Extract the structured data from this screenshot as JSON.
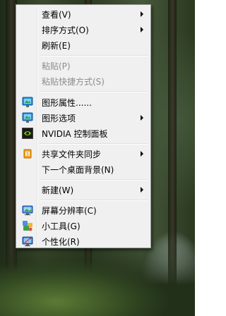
{
  "menu": {
    "items": [
      {
        "label": "查看(V)",
        "icon": "",
        "submenu": true
      },
      {
        "label": "排序方式(O)",
        "icon": "",
        "submenu": true
      },
      {
        "label": "刷新(E)",
        "icon": ""
      },
      {
        "label": "粘贴(P)",
        "icon": "",
        "disabled": true
      },
      {
        "label": "粘贴快捷方式(S)",
        "icon": "",
        "disabled": true
      },
      {
        "label": "图形属性......",
        "icon": "graphics-monitor-icon"
      },
      {
        "label": "图形选项",
        "icon": "graphics-monitor-icon",
        "submenu": true
      },
      {
        "label": "NVIDIA 控制面板",
        "icon": "nvidia-logo-icon"
      },
      {
        "label": "共享文件夹同步",
        "icon": "shared-folder-sync-icon",
        "submenu": true
      },
      {
        "label": "下一个桌面背景(N)",
        "icon": ""
      },
      {
        "label": "新建(W)",
        "icon": "",
        "submenu": true
      },
      {
        "label": "屏幕分辨率(C)",
        "icon": "display-resolution-icon"
      },
      {
        "label": "小工具(G)",
        "icon": "gadgets-icon"
      },
      {
        "label": "个性化(R)",
        "icon": "personalize-icon"
      }
    ]
  }
}
